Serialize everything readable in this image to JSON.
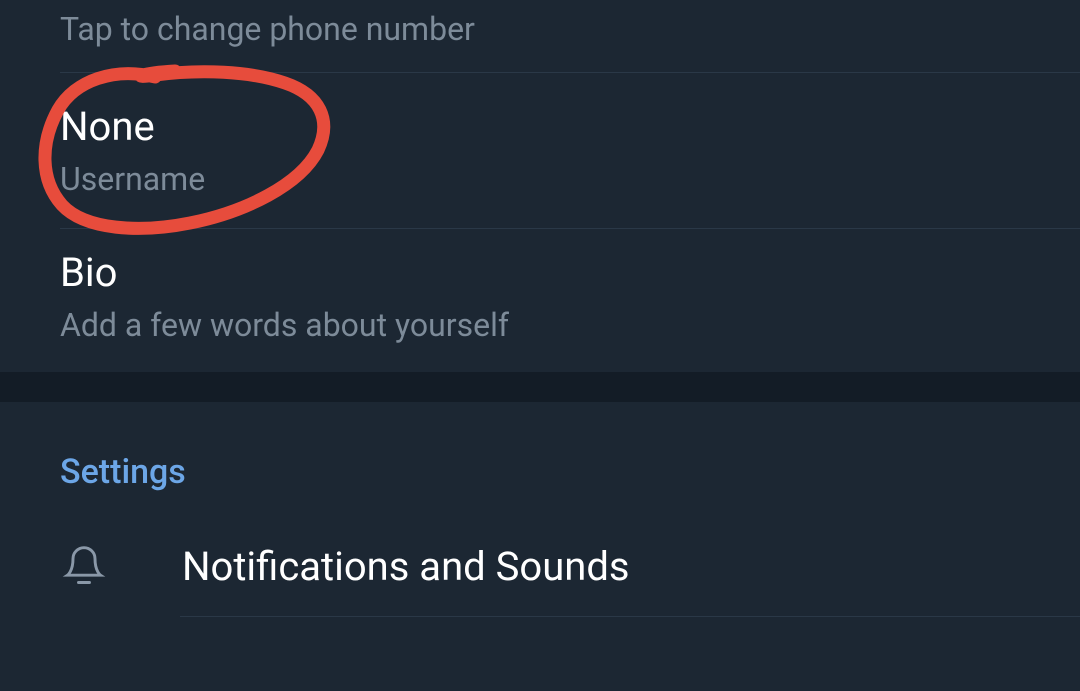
{
  "phone": {
    "hint": "Tap to change phone number"
  },
  "username": {
    "value": "None",
    "label": "Username"
  },
  "bio": {
    "title": "Bio",
    "hint": "Add a few words about yourself"
  },
  "settings": {
    "section_title": "Settings",
    "items": [
      {
        "label": "Notifications and Sounds",
        "icon": "bell"
      }
    ]
  },
  "annotation": {
    "color": "#e74c3c"
  }
}
